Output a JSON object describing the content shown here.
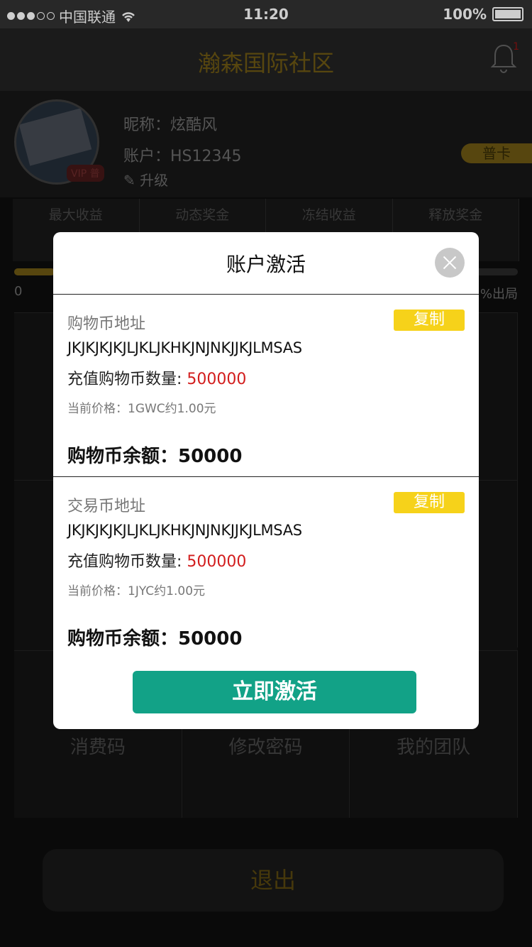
{
  "status_bar": {
    "carrier": "中国联通",
    "time": "11:20",
    "battery": "100%"
  },
  "header": {
    "title": "瀚森国际社区",
    "notification_count": "1"
  },
  "profile": {
    "nickname_label": "昵称：",
    "nickname": "炫酷风",
    "account_label": "账户：",
    "account": "HS12345",
    "upgrade": "升级",
    "vip_label": "VIP",
    "vip_level": "普",
    "card_type": "普卡"
  },
  "stats": [
    {
      "label": "最大收益"
    },
    {
      "label": "动态奖金"
    },
    {
      "label": "冻结收益"
    },
    {
      "label": "释放奖金"
    }
  ],
  "progress": {
    "left": "0",
    "right": "%出局",
    "value": 0.08
  },
  "grid": {
    "bottom_row": [
      "消费码",
      "修改密码",
      "我的团队"
    ]
  },
  "logout_label": "退出",
  "modal": {
    "title": "账户激活",
    "sections": [
      {
        "label": "购物币地址",
        "copy": "复制",
        "address": "JKJKJKJKJLJKLJKHKJNJNKJJKJLMSAS",
        "recharge_label": "充值购物币数量: ",
        "recharge_value": "500000",
        "price": "当前价格：1GWC约1.00元",
        "balance": "购物币余额：50000"
      },
      {
        "label": "交易币地址",
        "copy": "复制",
        "address": "JKJKJKJKJLJKLJKHKJNJNKJJKJLMSAS",
        "recharge_label": "充值购物币数量: ",
        "recharge_value": "500000",
        "price": "当前价格：1JYC约1.00元",
        "balance": "购物币余额：50000"
      }
    ],
    "activate": "立即激活"
  }
}
